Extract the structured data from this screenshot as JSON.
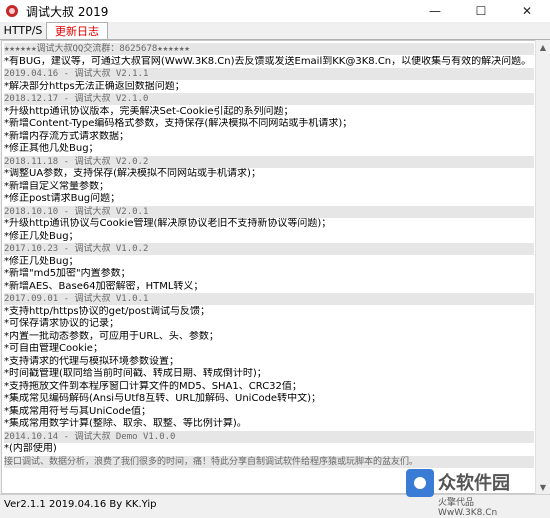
{
  "window": {
    "title": "调试大叔 2019",
    "minimize": "—",
    "maximize": "☐",
    "close": "✕"
  },
  "tabs": [
    {
      "label": "HTTP/S"
    },
    {
      "label": "更新日志"
    }
  ],
  "log": [
    {
      "type": "hdr",
      "text": "★★★★★★调试大叔QQ交流群：8625678★★★★★★"
    },
    {
      "type": "entry",
      "text": "*有BUG，建议等，可通过大叔官网(WwW.3K8.Cn)去反馈或发送Email到KK@3K8.Cn，以便收集与有效的解决问题。"
    },
    {
      "type": "hdr",
      "text": "2019.04.16 - 调试大叔 V2.1.1"
    },
    {
      "type": "entry",
      "text": "*解决部分https无法正确返回数据问题；"
    },
    {
      "type": "hdr",
      "text": "2018.12.17 - 调试大叔 V2.1.0"
    },
    {
      "type": "entry",
      "text": "*升级http通讯协议版本，完美解决Set-Cookie引起的系列问题；"
    },
    {
      "type": "entry",
      "text": "*新增Content-Type编码格式参数，支持保存(解决模拟不同网站或手机请求)；"
    },
    {
      "type": "entry",
      "text": "*新增内存流方式请求数据；"
    },
    {
      "type": "entry",
      "text": "*修正其他几处Bug；"
    },
    {
      "type": "hdr",
      "text": "2018.11.18 - 调试大叔 V2.0.2"
    },
    {
      "type": "entry",
      "text": "*调整UA参数，支持保存(解决模拟不同网站或手机请求)；"
    },
    {
      "type": "entry",
      "text": "*新增自定义常量参数；"
    },
    {
      "type": "entry",
      "text": "*修正post请求Bug问题；"
    },
    {
      "type": "hdr",
      "text": "2018.10.10 - 调试大叔 V2.0.1"
    },
    {
      "type": "entry",
      "text": "*升级http通讯协议与Cookie管理(解决原协议老旧不支持新协议等问题)；"
    },
    {
      "type": "entry",
      "text": "*修正几处Bug；"
    },
    {
      "type": "hdr",
      "text": "2017.10.23 - 调试大叔 V1.0.2"
    },
    {
      "type": "entry",
      "text": "*修正几处Bug；"
    },
    {
      "type": "entry",
      "text": "*新增\"md5加密\"内置参数；"
    },
    {
      "type": "entry",
      "text": "*新增AES、Base64加密解密，HTML转义；"
    },
    {
      "type": "hdr",
      "text": "2017.09.01 - 调试大叔 V1.0.1"
    },
    {
      "type": "entry",
      "text": "*支持http/https协议的get/post调试与反馈；"
    },
    {
      "type": "entry",
      "text": "*可保存请求协议的记录；"
    },
    {
      "type": "entry",
      "text": "*内置一批动态参数，可应用于URL、头、参数；"
    },
    {
      "type": "entry",
      "text": "*可自由管理Cookie；"
    },
    {
      "type": "entry",
      "text": "*支持请求的代理与模拟环境参数设置；"
    },
    {
      "type": "entry",
      "text": "*时间戳管理(取同给当前时间戳、转成日期、转成倒计时)；"
    },
    {
      "type": "entry",
      "text": "*支持拖放文件到本程序窗口计算文件的MD5、SHA1、CRC32值；"
    },
    {
      "type": "entry",
      "text": "*集成常见编码解码(Ansi与Utf8互转、URL加解码、UniCode转中文)；"
    },
    {
      "type": "entry",
      "text": "*集成常用符号与其UniCode值；"
    },
    {
      "type": "entry",
      "text": "*集成常用数学计算(整除、取余、取整、等比例计算)。"
    },
    {
      "type": "hdr",
      "text": "2014.10.14 - 调试大叔 Demo  V1.0.0"
    },
    {
      "type": "entry",
      "text": "*(内部使用)"
    },
    {
      "type": "hdr",
      "text": "接口调试、数据分析，浪费了我们很多的时间，痛！特此分享自制调试软件给程序猿或玩脚本的盆友们。"
    }
  ],
  "status": {
    "text": "Ver2.1.1 2019.04.16 By KK.Yip"
  },
  "watermark": {
    "brand": "众软件园",
    "url": "火擎代品 WwW.3K8.Cn"
  }
}
